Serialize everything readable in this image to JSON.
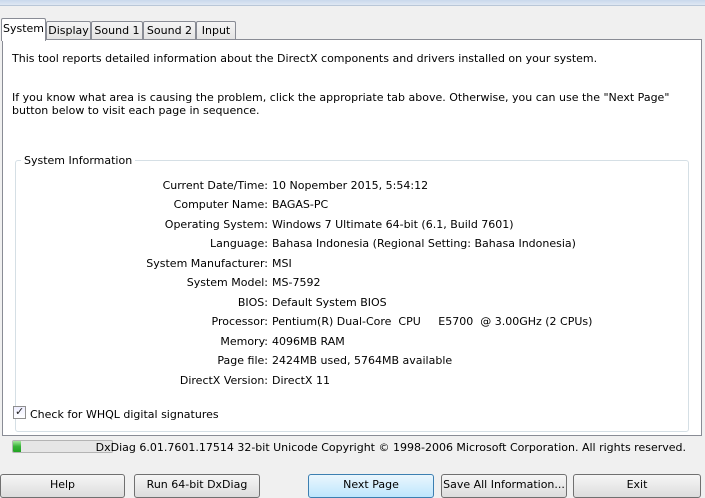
{
  "tabs": [
    "System",
    "Display",
    "Sound 1",
    "Sound 2",
    "Input"
  ],
  "intro": {
    "line1": "This tool reports detailed information about the DirectX components and drivers installed on your system.",
    "line2": "If you know what area is causing the problem, click the appropriate tab above.  Otherwise, you can use the \"Next Page\" button below to visit each page in sequence."
  },
  "system_info": {
    "title": "System Information",
    "rows": [
      {
        "label": "Current Date/Time:",
        "value": "10 Nopember 2015, 5:54:12"
      },
      {
        "label": "Computer Name:",
        "value": "BAGAS-PC"
      },
      {
        "label": "Operating System:",
        "value": "Windows 7 Ultimate 64-bit (6.1, Build 7601)"
      },
      {
        "label": "Language:",
        "value": "Bahasa Indonesia (Regional Setting: Bahasa Indonesia)"
      },
      {
        "label": "System Manufacturer:",
        "value": "MSI"
      },
      {
        "label": "System Model:",
        "value": "MS-7592"
      },
      {
        "label": "BIOS:",
        "value": "Default System BIOS"
      },
      {
        "label": "Processor:",
        "value": "Pentium(R) Dual-Core  CPU     E5700  @ 3.00GHz (2 CPUs)"
      },
      {
        "label": "Memory:",
        "value": "4096MB RAM"
      },
      {
        "label": "Page file:",
        "value": "2424MB used, 5764MB available"
      },
      {
        "label": "DirectX Version:",
        "value": "DirectX 11"
      }
    ]
  },
  "whql": {
    "label": "Check for WHQL digital signatures",
    "checked": true
  },
  "progress": {
    "fraction": 0.08
  },
  "copyright": "DxDiag 6.01.7601.17514 32-bit Unicode  Copyright © 1998-2006 Microsoft Corporation.  All rights reserved.",
  "buttons": {
    "help": "Help",
    "run64": "Run 64-bit DxDiag",
    "next": "Next Page",
    "save": "Save All Information...",
    "exit": "Exit"
  },
  "colors": {
    "accent": "#3c7fb1",
    "progress": "#37b337"
  }
}
